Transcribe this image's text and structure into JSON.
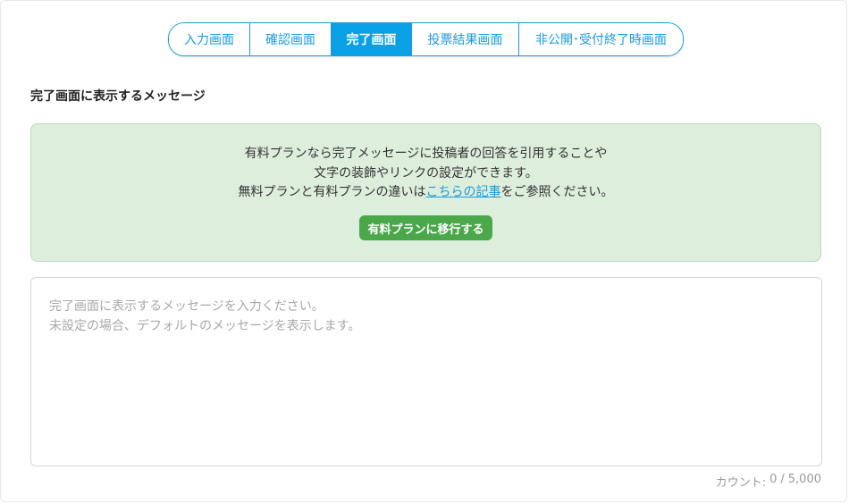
{
  "tabs": [
    {
      "label": "入力画面",
      "active": false
    },
    {
      "label": "確認画面",
      "active": false
    },
    {
      "label": "完了画面",
      "active": true
    },
    {
      "label": "投票結果画面",
      "active": false
    },
    {
      "label": "非公開･受付終了時画面",
      "active": false
    }
  ],
  "section": {
    "title": "完了画面に表示するメッセージ"
  },
  "notice": {
    "line1": "有料プランなら完了メッセージに投稿者の回答を引用することや",
    "line2": "文字の装飾やリンクの設定ができます。",
    "line3_prefix": "無料プランと有料プランの違いは",
    "line3_link": "こちらの記事",
    "line3_suffix": "をご参照ください。",
    "button_label": "有料プランに移行する"
  },
  "message": {
    "value": "",
    "placeholder": "完了画面に表示するメッセージを入力ください。\n未設定の場合、デフォルトのメッセージを表示します。"
  },
  "counter": {
    "label": "カウント:",
    "current": "0",
    "separator": "/",
    "max": "5,000"
  },
  "colors": {
    "accent": "#1a9bdb",
    "tab_active_bg": "#0aa0e6",
    "notice_bg": "#ddeedd",
    "button_green": "#4aa84a"
  }
}
